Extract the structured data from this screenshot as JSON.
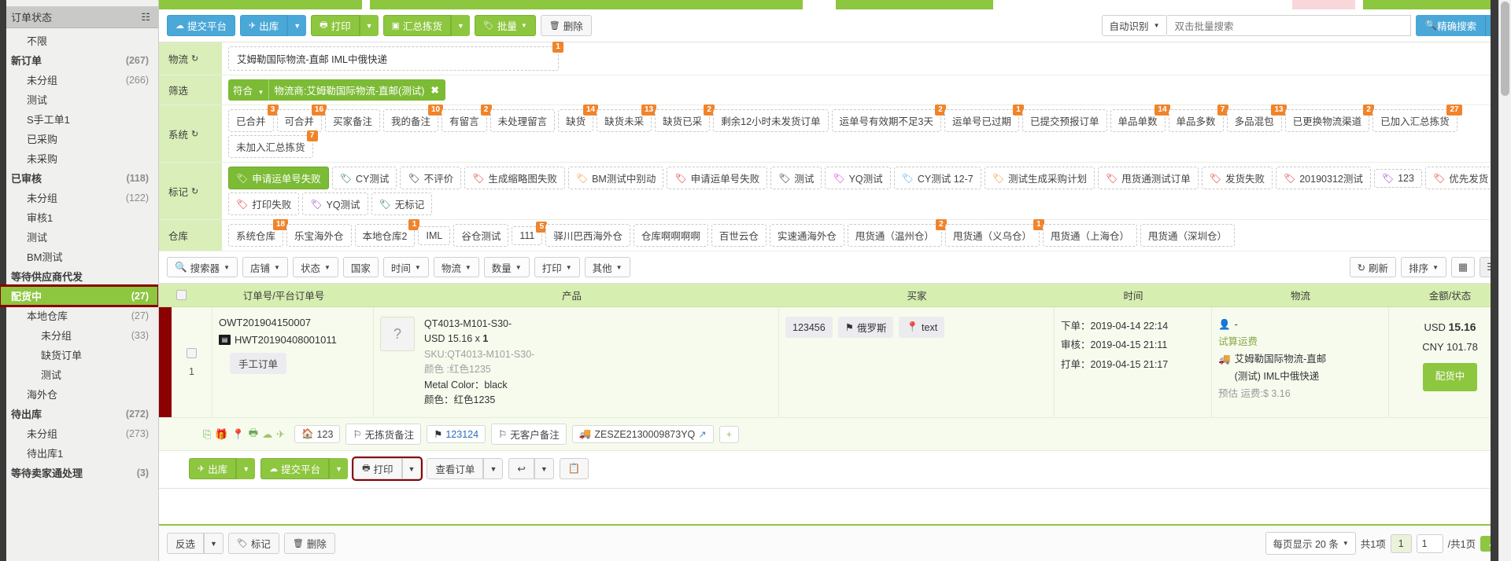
{
  "sidebar": {
    "header": {
      "title": "订单状态",
      "icon": "sitemap-icon"
    },
    "items": [
      {
        "label": "不限",
        "count": "",
        "level": 1,
        "active": false
      },
      {
        "label": "新订单",
        "count": "(267)",
        "level": 0,
        "active": false
      },
      {
        "label": "未分组",
        "count": "(266)",
        "level": 1,
        "active": false
      },
      {
        "label": "测试",
        "count": "",
        "level": 1,
        "active": false
      },
      {
        "label": "S手工单1",
        "count": "",
        "level": 1,
        "active": false
      },
      {
        "label": "已采购",
        "count": "",
        "level": 1,
        "active": false
      },
      {
        "label": "未采购",
        "count": "",
        "level": 1,
        "active": false
      },
      {
        "label": "已审核",
        "count": "(118)",
        "level": 0,
        "active": false
      },
      {
        "label": "未分组",
        "count": "(122)",
        "level": 1,
        "active": false
      },
      {
        "label": "审核1",
        "count": "",
        "level": 1,
        "active": false
      },
      {
        "label": "测试",
        "count": "",
        "level": 1,
        "active": false
      },
      {
        "label": "BM测试",
        "count": "",
        "level": 1,
        "active": false
      },
      {
        "label": "等待供应商代发",
        "count": "",
        "level": 0,
        "active": false
      },
      {
        "label": "配货中",
        "count": "(27)",
        "level": 0,
        "active": true
      },
      {
        "label": "本地仓库",
        "count": "(27)",
        "level": 1,
        "active": false
      },
      {
        "label": "未分组",
        "count": "(33)",
        "level": 2,
        "active": false
      },
      {
        "label": "缺货订单",
        "count": "",
        "level": 2,
        "active": false
      },
      {
        "label": "测试",
        "count": "",
        "level": 2,
        "active": false
      },
      {
        "label": "海外仓",
        "count": "",
        "level": 1,
        "active": false
      },
      {
        "label": "待出库",
        "count": "(272)",
        "level": 0,
        "active": false
      },
      {
        "label": "未分组",
        "count": "(273)",
        "level": 1,
        "active": false
      },
      {
        "label": "待出库1",
        "count": "",
        "level": 1,
        "active": false
      },
      {
        "label": "等待卖家通处理",
        "count": "(3)",
        "level": 0,
        "active": false
      }
    ]
  },
  "toolbar": {
    "submit_platform": "提交平台",
    "outbound": "出库",
    "print": "打印",
    "summary_pick": "汇总拣货",
    "batch": "批量",
    "delete": "删除",
    "auto_recognize": "自动识别",
    "search_placeholder": "双击批量搜索",
    "exact_search": "精确搜索"
  },
  "filters": {
    "logistics_label": "物流",
    "logistics_value": "艾姆勒国际物流-直邮 IML中俄快递",
    "logistics_badge": "1",
    "screen_label": "筛选",
    "screen_chip_prefix": "符合",
    "screen_chip_text": "物流商:艾姆勒国际物流-直邮(测试)",
    "system_label": "系统",
    "system_tags": [
      {
        "label": "已合并",
        "badge": "3"
      },
      {
        "label": "可合并",
        "badge": "16"
      },
      {
        "label": "买家备注",
        "badge": ""
      },
      {
        "label": "我的备注",
        "badge": "10"
      },
      {
        "label": "有留言",
        "badge": "2"
      },
      {
        "label": "未处理留言",
        "badge": ""
      },
      {
        "label": "缺货",
        "badge": "14"
      },
      {
        "label": "缺货未采",
        "badge": "13"
      },
      {
        "label": "缺货已采",
        "badge": "2"
      },
      {
        "label": "剩余12小时未发货订单",
        "badge": ""
      },
      {
        "label": "运单号有效期不足3天",
        "badge": "2"
      },
      {
        "label": "运单号已过期",
        "badge": "1"
      },
      {
        "label": "已提交预报订单",
        "badge": ""
      },
      {
        "label": "单品单数",
        "badge": "14"
      },
      {
        "label": "单品多数",
        "badge": "7"
      },
      {
        "label": "多品混包",
        "badge": "13"
      },
      {
        "label": "已更换物流渠道",
        "badge": "2"
      },
      {
        "label": "已加入汇总拣货",
        "badge": "27"
      },
      {
        "label": "未加入汇总拣货",
        "badge": "7"
      }
    ],
    "mark_label": "标记",
    "mark_tags": [
      {
        "label": "申请运单号失败",
        "color": "#ffffff",
        "selected": true
      },
      {
        "label": "CY测试",
        "color": "#1f6b3a",
        "selected": false
      },
      {
        "label": "不评价",
        "color": "#111111",
        "selected": false
      },
      {
        "label": "生成缩略图失败",
        "color": "#e02020",
        "selected": false
      },
      {
        "label": "BM测试中别动",
        "color": "#f28c28",
        "selected": false
      },
      {
        "label": "申请运单号失败",
        "color": "#e02020",
        "selected": false
      },
      {
        "label": "测试",
        "color": "#111111",
        "selected": false
      },
      {
        "label": "YQ测试",
        "color": "#e91ee0",
        "selected": false
      },
      {
        "label": "CY测试 12-7",
        "color": "#4aa8e8",
        "selected": false
      },
      {
        "label": "测试生成采购计划",
        "color": "#f28c28",
        "selected": false
      },
      {
        "label": "甩货通测试订单",
        "color": "#e02020",
        "selected": false
      },
      {
        "label": "发货失败",
        "color": "#e02020",
        "selected": false
      },
      {
        "label": "20190312测试",
        "color": "#e02020",
        "selected": false
      },
      {
        "label": "123",
        "color": "#9b30c0",
        "selected": false
      },
      {
        "label": "优先发货",
        "color": "#e02020",
        "selected": false
      },
      {
        "label": "打印失败",
        "color": "#e02020",
        "selected": false
      },
      {
        "label": "YQ测试",
        "color": "#9b30c0",
        "selected": false
      },
      {
        "label": "无标记",
        "color": "#1f6b3a",
        "selected": false
      }
    ],
    "warehouse_label": "仓库",
    "warehouse_tags": [
      {
        "label": "系统仓库",
        "badge": "18"
      },
      {
        "label": "乐宝海外仓",
        "badge": ""
      },
      {
        "label": "本地仓库2",
        "badge": "1"
      },
      {
        "label": "IML",
        "badge": ""
      },
      {
        "label": "谷仓测试",
        "badge": ""
      },
      {
        "label": "111",
        "badge": "5"
      },
      {
        "label": "驿川巴西海外仓",
        "badge": ""
      },
      {
        "label": "仓库啊啊啊啊",
        "badge": ""
      },
      {
        "label": "百世云仓",
        "badge": ""
      },
      {
        "label": "实速通海外仓",
        "badge": ""
      },
      {
        "label": "甩货通（温州仓）",
        "badge": "2"
      },
      {
        "label": "甩货通（义乌仓）",
        "badge": "1"
      },
      {
        "label": "甩货通（上海仓）",
        "badge": ""
      },
      {
        "label": "甩货通（深圳仓）",
        "badge": ""
      }
    ]
  },
  "search_row": {
    "dropdowns": [
      "搜索器",
      "店铺",
      "状态",
      "国家",
      "时间",
      "物流",
      "数量",
      "打印",
      "其他"
    ],
    "refresh": "刷新",
    "sort": "排序"
  },
  "table": {
    "columns": [
      "订单号/平台订单号",
      "产品",
      "买家",
      "时间",
      "物流",
      "金额/状态"
    ],
    "row": {
      "index": "1",
      "order_no": "OWT201904150007",
      "platform_order_no": "HWT20190408001011",
      "manual_tag": "手工订单",
      "product": {
        "title": "QT4013-M101-S30-",
        "price_line": "USD 15.16 x ",
        "qty": "1",
        "sku": "SKU:QT4013-M101-S30-",
        "attr_grey": "颜色 :红色1235",
        "attr1": "Metal Color：black",
        "attr2": "颜色：红色1235",
        "no_image": "?"
      },
      "buyer": {
        "id": "123456",
        "country": "俄罗斯",
        "address": "text"
      },
      "time": {
        "order_label": "下单：",
        "order_value": "2019-04-14 22:14",
        "audit_label": "审核：",
        "audit_value": "2019-04-15 21:11",
        "print_label": "打单：",
        "print_value": "2019-04-15 21:17"
      },
      "logistics": {
        "person": "-",
        "calc_link": "试算运费",
        "channel_line1": "艾姆勒国际物流-直邮",
        "channel_line2": "(测试) IML中俄快递",
        "estimate": "预估 运费:$ 3.16"
      },
      "amount": {
        "usd_label": "USD",
        "usd_value": "15.16",
        "cny_label": "CNY",
        "cny_value": "101.78",
        "status": "配货中"
      },
      "sub_actions": {
        "home_tag": "123",
        "pick_note": "无拣货备注",
        "flag_num": "123124",
        "cust_note": "无客户备注",
        "tracking": "ZESZE2130009873YQ",
        "plus": "+"
      },
      "row_actions": {
        "outbound": "出库",
        "submit_platform": "提交平台",
        "print": "打印",
        "view_order": "查看订单"
      }
    }
  },
  "footer": {
    "invert": "反选",
    "mark": "标记",
    "delete": "删除",
    "per_page": "每页显示 20 条",
    "total": "共1项",
    "page_current": "1",
    "page_input": "1",
    "page_total": "/共1页"
  },
  "colors": {
    "brand_green": "#8dc63f",
    "blue": "#4aa8d8",
    "badge_orange": "#f0842a",
    "highlight_red": "#8b0000"
  }
}
